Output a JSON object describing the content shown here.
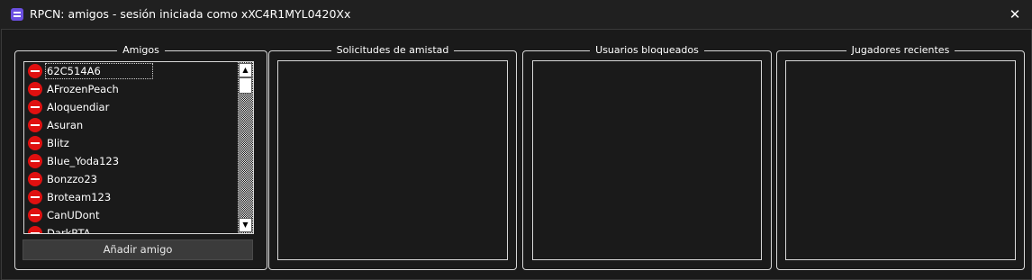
{
  "window": {
    "title": "RPCN: amigos - sesión iniciada como xXC4R1MYL0420Xx",
    "app_icon": "rpcn-app-icon",
    "close_symbol": "✕"
  },
  "friends": {
    "title": "Amigos",
    "items": [
      "62C514A6",
      "AFrozenPeach",
      "Aloquendiar",
      "Asuran",
      "Blitz",
      "Blue_Yoda123",
      "Bonzzo23",
      "Broteam123",
      "CanUDont",
      "DarkRTA"
    ],
    "selected_index": 0,
    "item_icon": "block-icon",
    "add_button": "Añadir amigo",
    "scroll_up": "▲",
    "scroll_down": "▼"
  },
  "requests": {
    "title": "Solicitudes de amistad"
  },
  "blocked": {
    "title": "Usuarios bloqueados"
  },
  "recent": {
    "title": "Jugadores recientes"
  },
  "colors": {
    "block_icon": "#e01010",
    "app_icon": "#6b4fe0",
    "background": "#1a1a1a"
  }
}
